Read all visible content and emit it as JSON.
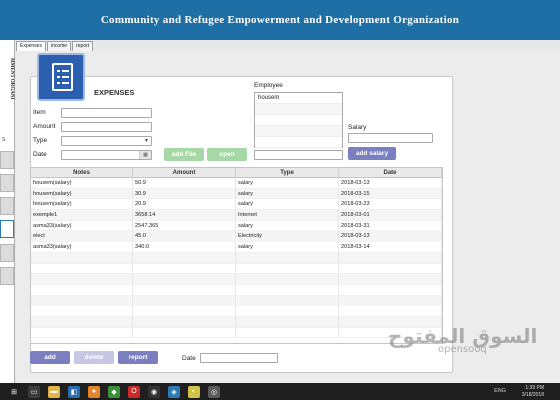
{
  "app": {
    "title": "Community and Refugee Empowerment and Development Organization",
    "side_logo_text": "MMENT ORGANI",
    "side_letter": "S"
  },
  "tabs": [
    {
      "label": "Expenses",
      "active": true
    },
    {
      "label": "income",
      "active": false
    },
    {
      "label": "report",
      "active": false
    }
  ],
  "form": {
    "heading": "EXPENSES",
    "item_label": "Item",
    "item_value": "",
    "amount_label": "Amount",
    "amount_value": "",
    "type_label": "Type",
    "type_value": "",
    "date_label": "Date",
    "date_value": "",
    "add_file_label": "add File",
    "open_label": "open",
    "employee_label": "Employee",
    "employees": [
      "housem",
      "",
      "",
      "",
      ""
    ],
    "employee_search_value": "",
    "salary_label": "Salary",
    "salary_value": "",
    "add_salary_label": "add salary"
  },
  "table": {
    "columns": [
      "Notes",
      "Amount",
      "Type",
      "Date"
    ],
    "rows": [
      [
        "housem(salary)",
        "50.9",
        "salary",
        "2018-03-13"
      ],
      [
        "housem(salary)",
        "30.9",
        "salary",
        "2018-03-15"
      ],
      [
        "housem(salary)",
        "20.9",
        "salary",
        "2018-03-23"
      ],
      [
        "exemple1",
        "3658.14",
        "Internet",
        "2018-03-01"
      ],
      [
        "asma33(salary)",
        "2547.365",
        "salary",
        "2018-03-31"
      ],
      [
        "elect",
        "45.0",
        "Electricity",
        "2018-03-13"
      ],
      [
        "asma33(salary)",
        "340.0",
        "salary",
        "2018-03-14"
      ],
      [
        "",
        "",
        "",
        ""
      ],
      [
        "",
        "",
        "",
        ""
      ],
      [
        "",
        "",
        "",
        ""
      ],
      [
        "",
        "",
        "",
        ""
      ],
      [
        "",
        "",
        "",
        ""
      ],
      [
        "",
        "",
        "",
        ""
      ],
      [
        "",
        "",
        "",
        ""
      ],
      [
        "",
        "",
        "",
        ""
      ]
    ]
  },
  "bottom": {
    "add_label": "add",
    "delete_label": "delete",
    "report_label": "report",
    "date_label": "Date",
    "date_value": ""
  },
  "taskbar": {
    "time": "1:39 PM",
    "date": "3/18/2018",
    "lang": "ENG"
  },
  "watermark": {
    "arabic": "السوق المفتوح",
    "latin": "opensooq"
  },
  "colors": {
    "title_bar": "#1e6fa6",
    "button_blue": "#7b7fbf",
    "button_green": "#a6d8a5",
    "logo_blue": "#2c5fb0"
  }
}
